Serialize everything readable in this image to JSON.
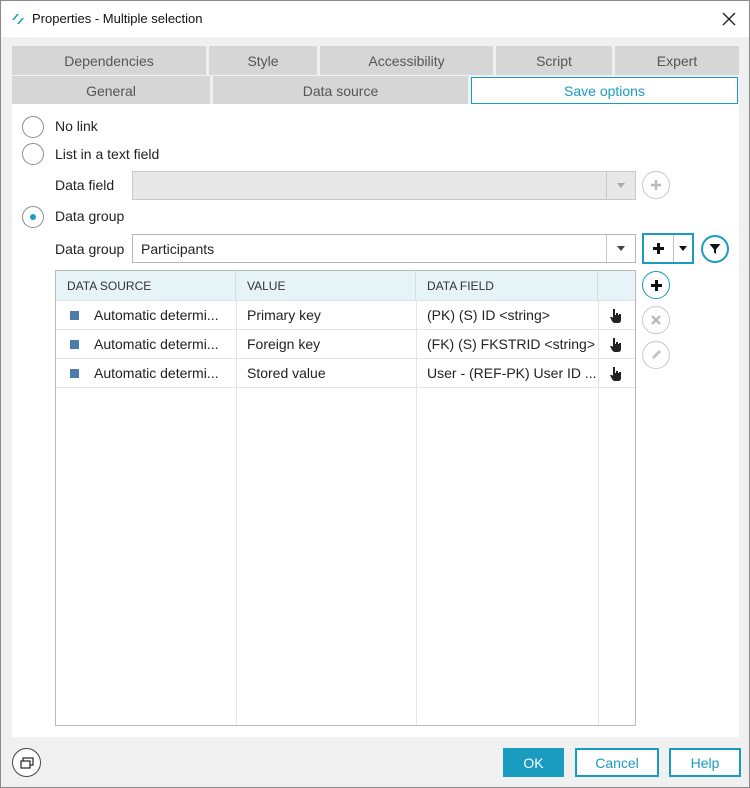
{
  "window": {
    "title": "Properties - Multiple selection"
  },
  "tabs": {
    "row1": [
      {
        "label": "Dependencies"
      },
      {
        "label": "Style"
      },
      {
        "label": "Accessibility"
      },
      {
        "label": "Script"
      },
      {
        "label": "Expert"
      }
    ],
    "row2": [
      {
        "label": "General"
      },
      {
        "label": "Data source"
      },
      {
        "label": "Save options"
      }
    ],
    "active": "Save options"
  },
  "options": {
    "no_link": "No link",
    "list_in_text_field": "List in a text field",
    "data_field_label": "Data field",
    "data_field_value": "",
    "data_group": "Data group",
    "data_group_label": "Data group",
    "data_group_value": "Participants",
    "selected": "Data group"
  },
  "grid": {
    "headers": [
      "DATA SOURCE",
      "VALUE",
      "DATA FIELD"
    ],
    "rows": [
      {
        "source": "Automatic determi...",
        "value": "Primary key",
        "field": "(PK) (S) ID <string>"
      },
      {
        "source": "Automatic determi...",
        "value": "Foreign key",
        "field": "(FK) (S) FKSTRID <string>"
      },
      {
        "source": "Automatic determi...",
        "value": "Stored value",
        "field": "User - (REF-PK) User ID ..."
      }
    ]
  },
  "footer": {
    "ok": "OK",
    "cancel": "Cancel",
    "help": "Help"
  },
  "colors": {
    "accent": "#1a9bc0",
    "row_marker": "#4b7daa",
    "tab_inactive": "#d6d6d6",
    "header_bg": "#e6f3f7"
  },
  "icons": {
    "app": "app-logo-icon",
    "close": "close-icon",
    "add": "plus-icon",
    "filter": "filter-icon",
    "delete": "x-icon",
    "edit": "pencil-icon",
    "row_action": "hand-pointer-icon",
    "window_mode": "window-mode-icon"
  }
}
